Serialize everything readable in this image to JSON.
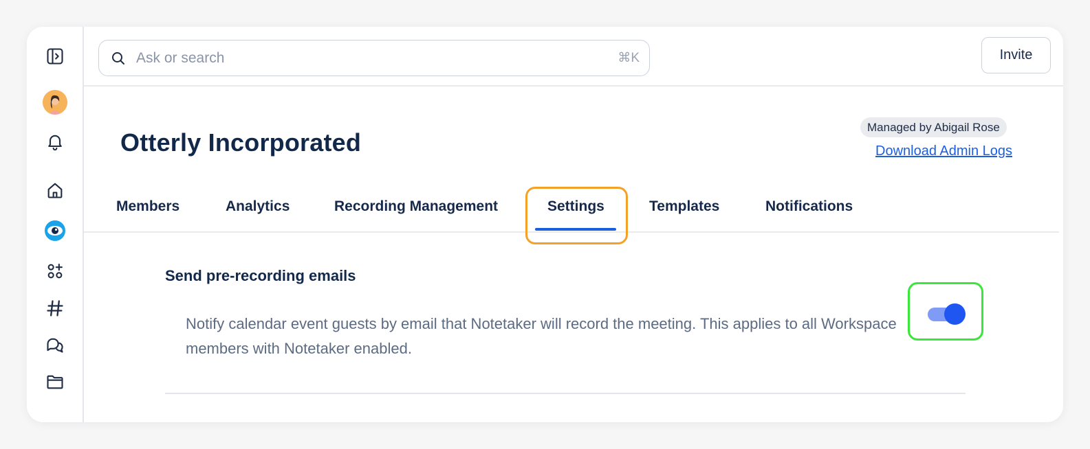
{
  "search": {
    "placeholder": "Ask or search",
    "shortcut": "⌘K"
  },
  "topbar": {
    "invite_label": "Invite"
  },
  "header": {
    "title": "Otterly Incorporated",
    "managed_by": "Managed by Abigail Rose",
    "download_logs": "Download Admin Logs"
  },
  "tabs": [
    {
      "label": "Members"
    },
    {
      "label": "Analytics"
    },
    {
      "label": "Recording Management"
    },
    {
      "label": "Settings",
      "active": true
    },
    {
      "label": "Templates"
    },
    {
      "label": "Notifications"
    }
  ],
  "setting": {
    "title": "Send pre-recording emails",
    "description": "Notify calendar event guests by email that Notetaker will record the meeting. This applies to all Workspace members with Notetaker enabled.",
    "enabled": true
  },
  "sidebar": {
    "icons": [
      "sidebar-toggle-icon",
      "avatar",
      "bell-icon",
      "home-icon",
      "otter-logo-icon",
      "apps-add-icon",
      "hash-icon",
      "chat-icon",
      "folder-icon"
    ]
  },
  "colors": {
    "accent": "#1a5fe0",
    "tab_highlight": "#f4a227",
    "toggle_highlight": "#39e639",
    "title": "#12284a"
  }
}
